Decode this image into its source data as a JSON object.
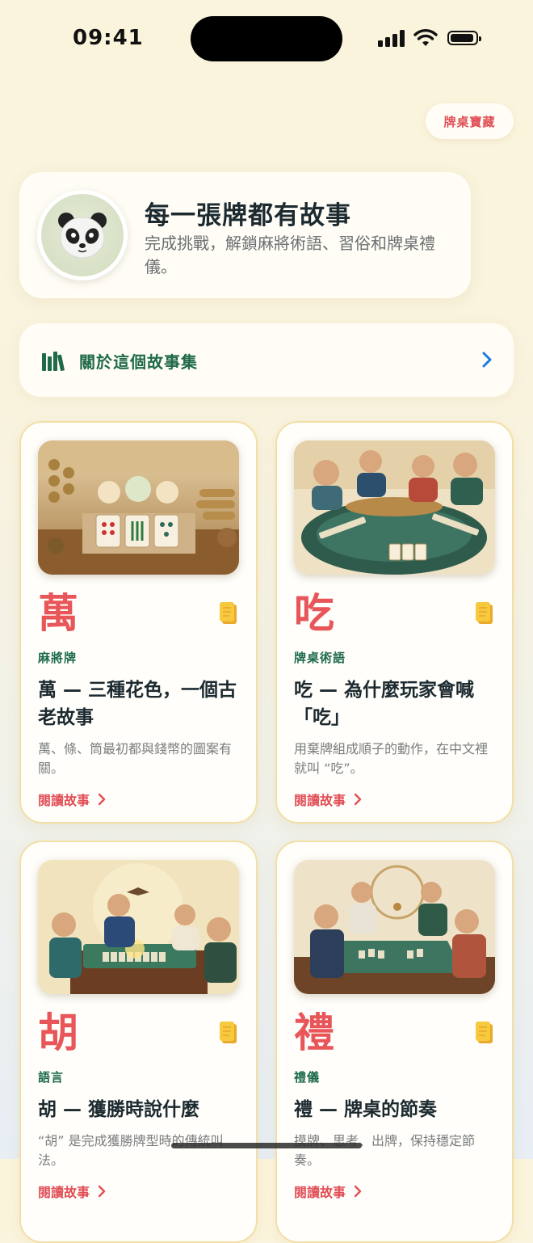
{
  "status": {
    "time": "09:41"
  },
  "header": {
    "treasure_button": "牌桌寶藏"
  },
  "hero": {
    "title": "每一張牌都有故事",
    "description": "完成挑戰，解鎖麻將術語、習俗和牌桌禮儀。",
    "avatar": "panda-emoji"
  },
  "about": {
    "label": "關於這個故事集"
  },
  "stories": [
    {
      "glyph": "萬",
      "category": "麻將牌",
      "title": "萬 — 三種花色，一個古老故事",
      "description": "萬、條、筒最初都與錢幣的圖案有關。",
      "link": "閱讀故事"
    },
    {
      "glyph": "吃",
      "category": "牌桌術語",
      "title": "吃 — 為什麼玩家會喊「吃」",
      "description": "用棄牌組成順子的動作，在中文裡就叫 “吃”。",
      "link": "閱讀故事"
    },
    {
      "glyph": "胡",
      "category": "語言",
      "title": "胡 — 獲勝時說什麼",
      "description": "“胡” 是完成獲勝牌型時的傳統叫法。",
      "link": "閱讀故事"
    },
    {
      "glyph": "禮",
      "category": "禮儀",
      "title": "禮 — 牌桌的節奏",
      "description": "摸牌、思考、出牌，保持穩定節奏。",
      "link": "閱讀故事"
    }
  ],
  "colors": {
    "accent_red": "#e8565a",
    "accent_green": "#1d6a4b",
    "card_border": "#f3dfa6"
  }
}
